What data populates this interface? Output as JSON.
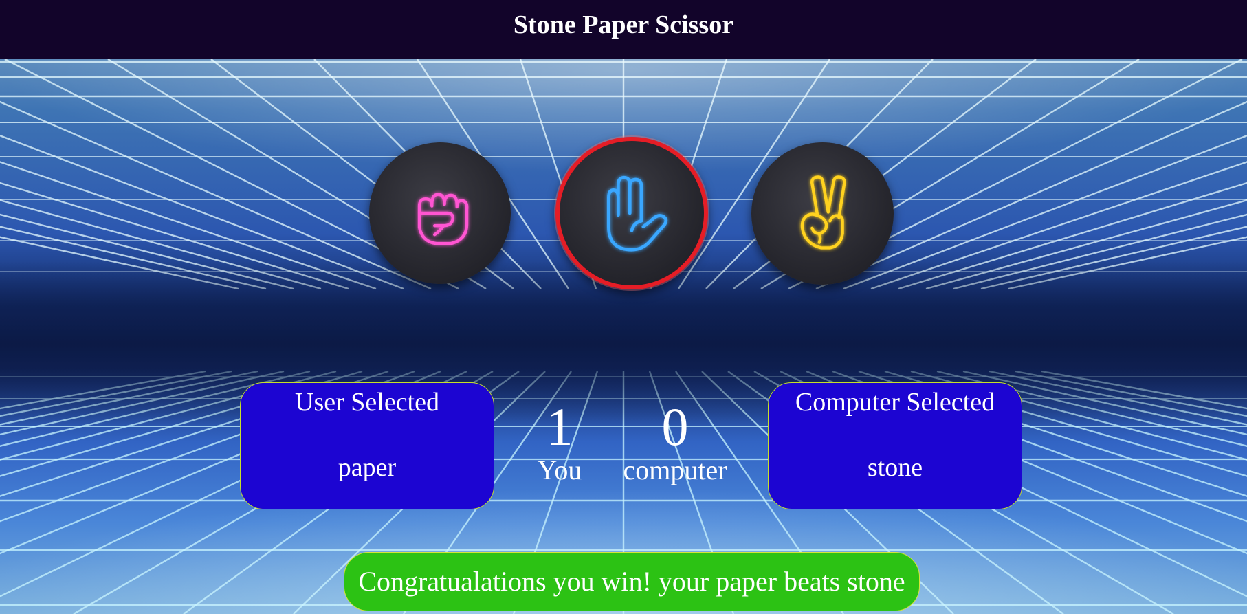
{
  "app": {
    "title": "Stone Paper Scissor"
  },
  "choices": [
    {
      "id": "stone",
      "icon": "fist-icon",
      "color": "#ff55d2",
      "selected": false
    },
    {
      "id": "paper",
      "icon": "open-hand-icon",
      "color": "#3aa7ff",
      "selected": true
    },
    {
      "id": "scissor",
      "icon": "victory-hand-icon",
      "color": "#ffd21f",
      "selected": false
    }
  ],
  "user_panel": {
    "title": "User Selected",
    "value": "paper"
  },
  "computer_panel": {
    "title": "Computer Selected",
    "value": "stone"
  },
  "scoreboard": {
    "user_score": "1",
    "user_label": "You",
    "computer_score": "0",
    "computer_label": "computer"
  },
  "message": {
    "text": "Congratualations you win! your paper beats stone"
  },
  "colors": {
    "navbar": "#12042a",
    "panel": "#1c05d2",
    "message": "#2cc214",
    "selected_ring": "#e51d26"
  }
}
